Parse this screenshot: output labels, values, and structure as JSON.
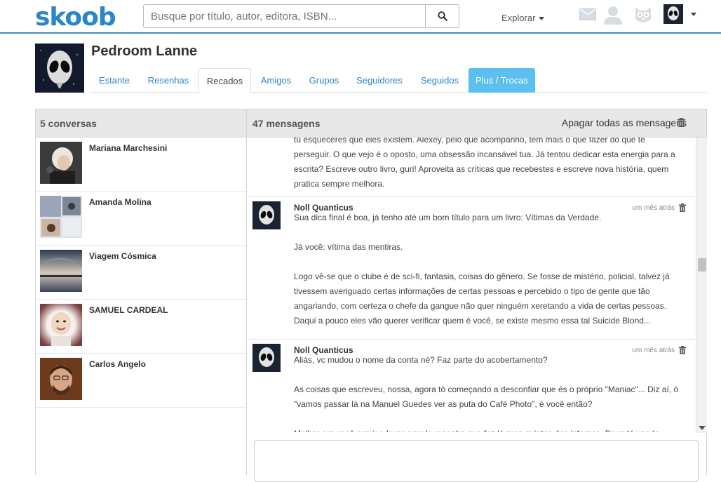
{
  "header": {
    "logo": "skoob",
    "search_placeholder": "Busque por título, autor, editora, ISBN...",
    "explore_label": "Explorar",
    "icons": [
      "envelope-icon",
      "user-icon",
      "owl-icon",
      "avatar",
      "chevron-down-icon"
    ]
  },
  "profile": {
    "name": "Pedroom Lanne",
    "tabs": [
      {
        "label": "Estante"
      },
      {
        "label": "Resenhas"
      },
      {
        "label": "Recados",
        "active": true
      },
      {
        "label": "Amigos"
      },
      {
        "label": "Grupos"
      },
      {
        "label": "Seguidores"
      },
      {
        "label": "Seguidos"
      },
      {
        "label": "Plus / Trocas",
        "highlight": true
      }
    ]
  },
  "conversations": {
    "heading": "5 conversas",
    "items": [
      {
        "name": "Mariana Marchesini"
      },
      {
        "name": "Amanda Molina"
      },
      {
        "name": "Viagem Cósmica"
      },
      {
        "name": "SAMUEL CARDEAL"
      },
      {
        "name": "Carlos Angelo"
      }
    ]
  },
  "messages": {
    "heading": "47 mensagens",
    "delete_all_label": "Apagar todas as mensagens",
    "partial_top": [
      "tu esqueceres que eles existem. Alexey, pelo que acompanho, tem mais o que fazer do que te",
      "perseguir. O que vejo é o oposto, uma obsessão incansável tua. Já tentou dedicar esta energia para a",
      "escrita? Escreve outro livro, guri! Aproveita as críticas que recebestes e escreve nova história, quem",
      "pratica sempre melhora."
    ],
    "items": [
      {
        "author": "Noll Quanticus",
        "time": "um mês atrás",
        "lines": [
          "Sua dica final é boa, já tenho até um bom título para um livro: Vítimas da Verdade.",
          "",
          "Já você: vítima das mentiras.",
          "",
          "Logo vê-se que o clube é de sci-fi, fantasia, coisas do gênero. Se fosse de mistério, policial, talvez já",
          "tivessem averiguado certas informações de certas pessoas e percebido o tipo de gente que tão",
          "angariando, com certeza o chefe da gangue não quer ninguém xeretando a vida de certas pessoas.",
          "Daqui a pouco eles vão querer verificar quem é você, se existe mesmo essa tal Suicide Blond..."
        ]
      },
      {
        "author": "Noll Quanticus",
        "time": "um mês atrás",
        "lines": [
          "Aliás, vc mudou o nome da conta né? Faz parte do acobertamento?",
          "",
          "As coisas que escreveu, nossa, agora tô começando a desconfiar que és o próprio \"Maniac\"... Diz aí, ó",
          "\"vamos passar lá na Manuel Guedes ver as puta do Café Photo\", é você então?",
          "",
          "Melhor era você sumir e levar aquela resenha que fez lá pros quintos dos infernos. Deus tá vendo"
        ]
      }
    ]
  },
  "colors": {
    "brand": "#2a86c6",
    "tab_highlight": "#5bc0f0",
    "panel_header": "#e8e8e8"
  }
}
